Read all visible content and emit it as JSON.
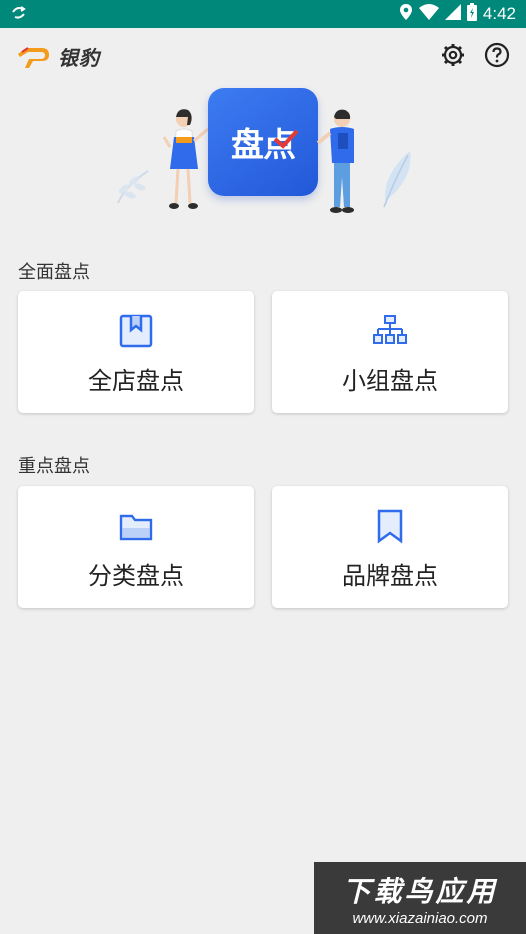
{
  "status_bar": {
    "time": "4:42",
    "icons": [
      "sync-icon",
      "location-icon",
      "wifi-icon",
      "signal-icon",
      "battery-icon"
    ]
  },
  "app": {
    "logo_text": "银豹",
    "settings_icon": "gear-icon",
    "help_icon": "help-icon"
  },
  "hero": {
    "title": "盘点"
  },
  "sections": [
    {
      "label": "全面盘点",
      "cards": [
        {
          "label": "全店盘点",
          "icon": "box-icon"
        },
        {
          "label": "小组盘点",
          "icon": "org-chart-icon"
        }
      ]
    },
    {
      "label": "重点盘点",
      "cards": [
        {
          "label": "分类盘点",
          "icon": "folder-icon"
        },
        {
          "label": "品牌盘点",
          "icon": "bookmark-icon"
        }
      ]
    }
  ],
  "watermark": {
    "title": "下载鸟应用",
    "url": "www.xiazainiao.com"
  },
  "colors": {
    "status_bar": "#00897b",
    "accent_blue": "#2f6bea",
    "background": "#efefef",
    "logo_orange": "#f29b1d",
    "check_red": "#e53935"
  }
}
